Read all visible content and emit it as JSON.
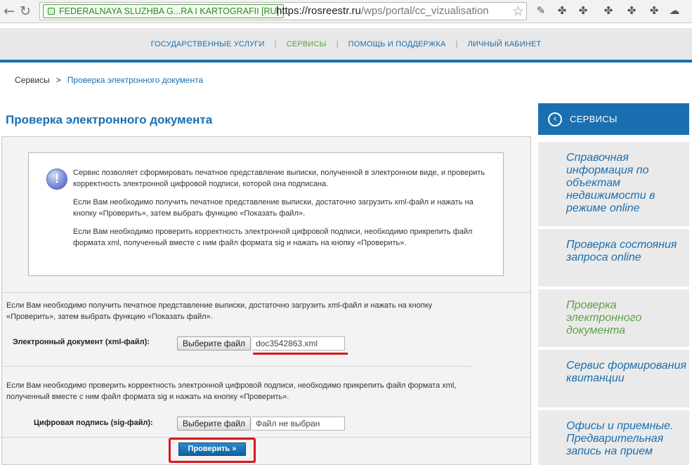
{
  "browser": {
    "ev_label": "FEDERALNAYA SLUZHBA G...RA I KARTOGRAFII [RU]",
    "url_host": "https://rosreestr.ru",
    "url_path": "/wps/portal/cc_vizualisation"
  },
  "topnav": {
    "items": [
      "ГОСУДАРСТВЕННЫЕ УСЛУГИ",
      "СЕРВИСЫ",
      "ПОМОЩЬ И ПОДДЕРЖКА",
      "ЛИЧНЫЙ КАБИНЕТ"
    ],
    "active": "СЕРВИСЫ"
  },
  "breadcrumb": {
    "root": "Сервисы",
    "separator": ">",
    "current": "Проверка электронного документа"
  },
  "page_title": "Проверка электронного документа",
  "info": {
    "p1": "Сервис позволяет сформировать печатное представление выписки, полученной в электронном виде, и проверить корректность электронной цифровой подписи, которой она подписана.",
    "p2": "Если Вам необходимо получить печатное представление выписки, достаточно загрузить xml-файл и нажать на кнопку «Проверить», затем выбрать функцию «Показать файл».",
    "p3": "Если Вам необходимо проверить корректность электронной цифровой подписи, необходимо прикрепить файл формата xml, полученный вместе с ним файл формата sig и нажать на кнопку «Проверить»."
  },
  "form": {
    "xml_desc": "Если Вам необходимо получить печатное представление выписки, достаточно загрузить xml-файл и нажать на кнопку «Проверить», затем выбрать функцию «Показать файл».",
    "xml_label": "Электронный документ (xml-файл):",
    "xml_button": "Выберите файл",
    "xml_file": "doc3542863.xml",
    "sig_desc": "Если Вам необходимо проверить корректность электронной цифровой подписи, необходимо прикрепить файл формата xml, полученный вместе с ним файл формата sig и нажать на кнопку «Проверить».",
    "sig_label": "Цифровая подпись (sig-файл):",
    "sig_button": "Выберите файл",
    "sig_file": "Файл не выбран",
    "submit": "Проверить »"
  },
  "sidebar": {
    "title": "СЕРВИСЫ",
    "items": [
      "Справочная информация по объектам недвижимости в режиме online",
      "Проверка состояния запроса online",
      "Проверка электронного документа",
      "Сервис формирования квитанции",
      "Офисы и приемные. Предварительная запись на прием"
    ],
    "active_index": 2
  },
  "colors": {
    "brand_blue": "#1a6fb0",
    "active_green": "#5aa246",
    "highlight_red": "#d8161d"
  }
}
